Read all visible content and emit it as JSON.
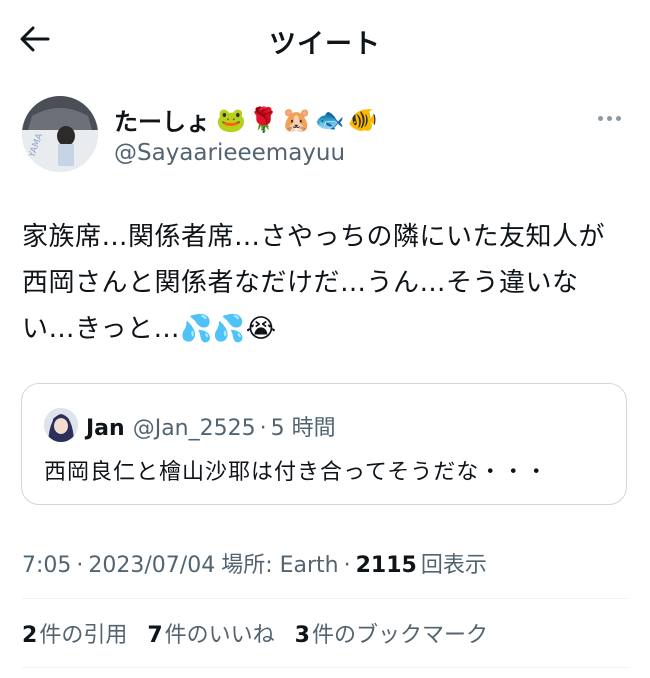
{
  "header": {
    "title": "ツイート"
  },
  "tweet": {
    "author": {
      "display_name": "たーしょ",
      "name_emojis": "🐸🌹🐹🐟🐠",
      "handle": "@Sayaarieeemayuu"
    },
    "text_lines": [
      "家族席…関係者席…さやっちの隣にいた友知人が",
      "西岡さんと関係者なだけだ…うん…そう違いな",
      "い…きっと…💦💦😭"
    ],
    "quote": {
      "name": "Jan",
      "handle": "@Jan_2525",
      "dot": "·",
      "time": "5 時間",
      "text": "西岡良仁と檜山沙耶は付き合ってそうだな・・・"
    },
    "meta": {
      "time": "7:05",
      "sep1": "·",
      "date": "2023/07/04",
      "location": "場所: Earth",
      "sep2": "·",
      "views_count": "2115",
      "views_label": "回表示"
    },
    "stats": {
      "quotes_count": "2",
      "quotes_label": "件の引用",
      "likes_count": "7",
      "likes_label": "件のいいね",
      "bookmarks_count": "3",
      "bookmarks_label": "件のブックマーク"
    }
  },
  "icons": {
    "back": "arrow-left-icon",
    "more": "more-horizontal-icon"
  },
  "colors": {
    "text": "#0f1419",
    "secondary": "#536471",
    "border": "#cfd9de",
    "divider": "#eff3f4"
  }
}
